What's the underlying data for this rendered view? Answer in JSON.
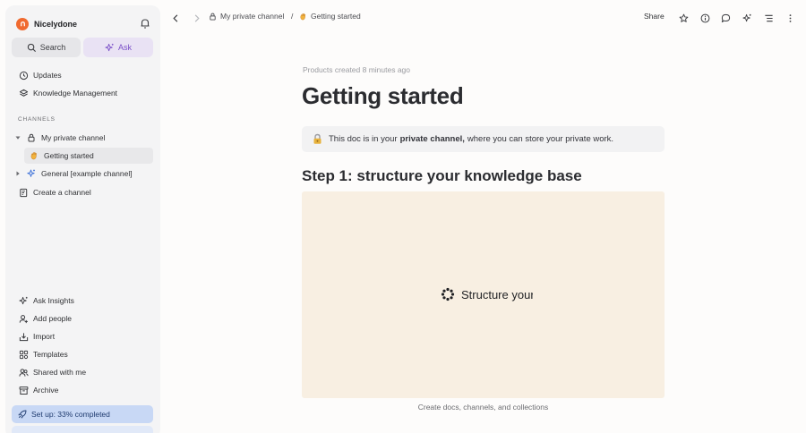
{
  "workspace": {
    "name": "Nicelydone"
  },
  "sidebar": {
    "search_label": "Search",
    "ask_label": "Ask",
    "top_items": [
      {
        "label": "Updates",
        "icon": "clock-icon"
      },
      {
        "label": "Knowledge Management",
        "icon": "layers-icon"
      }
    ],
    "channels_heading": "CHANNELS",
    "channels": [
      {
        "label": "My private channel",
        "icon": "lock-icon",
        "expanded": true
      },
      {
        "label": "Getting started",
        "icon": "hand-wave-icon",
        "active": true
      },
      {
        "label": "General [example channel]",
        "icon": "sparkle-icon",
        "expanded": false
      },
      {
        "label": "Create a channel",
        "icon": "create-channel-icon"
      }
    ],
    "bottom_items": [
      {
        "label": "Ask Insights",
        "icon": "sparkle-icon"
      },
      {
        "label": "Add people",
        "icon": "add-person-icon"
      },
      {
        "label": "Import",
        "icon": "import-icon"
      },
      {
        "label": "Templates",
        "icon": "templates-icon"
      },
      {
        "label": "Shared with me",
        "icon": "people-icon"
      },
      {
        "label": "Archive",
        "icon": "archive-icon"
      }
    ],
    "setup_label": "Set up: 33% completed",
    "setup_progress": 0.33
  },
  "topbar": {
    "breadcrumb_channel": "My private channel",
    "breadcrumb_separator": "/",
    "breadcrumb_doc": "Getting started",
    "share_label": "Share"
  },
  "doc": {
    "meta": "Products created 8 minutes ago",
    "title": "Getting started",
    "notice_prefix": "This doc is in your",
    "notice_bold": "private channel,",
    "notice_suffix": "where you can store your private work.",
    "heading": "Step 1: structure your knowledge base",
    "media_text": "Structure your",
    "caption": "Create docs, channels, and collections"
  },
  "colors": {
    "accent_purple": "#7a4fc8",
    "brand_orange": "#f06a2f",
    "setup_blue": "#c8d8f5",
    "media_bg": "#f8efe2"
  }
}
